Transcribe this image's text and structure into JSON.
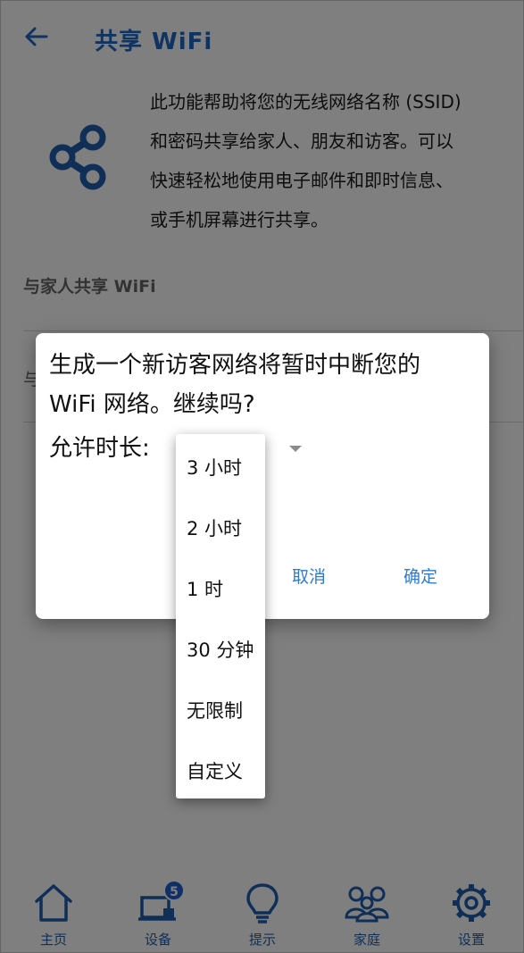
{
  "header": {
    "title": "共享 WiFi"
  },
  "intro": {
    "lines": [
      "此功能帮助将您的无线网络名称 (SSID)",
      "和密码共享给家人、朋友和访客。可以",
      "快速轻松地使用电子邮件和即时信息、",
      "或手机屏幕进行共享。"
    ]
  },
  "sections": {
    "family_label": "与家人共享 WiFi",
    "row2_partial": "与"
  },
  "dialog": {
    "message_line1": "生成一个新访客网络将暂时中断您的",
    "message_line2": "WiFi 网络。继续吗?",
    "duration_label": "允许时长:",
    "cancel_label": "取消",
    "ok_label": "确定"
  },
  "duration_menu": {
    "options": [
      "3 小时",
      "2 小时",
      "1 时",
      "30 分钟",
      "无限制",
      "自定义"
    ]
  },
  "bottom_nav": {
    "items": [
      {
        "label": "主页",
        "icon": "home-icon"
      },
      {
        "label": "设备",
        "icon": "devices-icon",
        "badge": "5"
      },
      {
        "label": "提示",
        "icon": "lightbulb-icon"
      },
      {
        "label": "家庭",
        "icon": "family-icon"
      },
      {
        "label": "设置",
        "icon": "gear-icon"
      }
    ]
  },
  "colors": {
    "accent": "#1f69c2",
    "overlay": "rgba(0,0,0,0.5)",
    "badge": "#1e5fd0"
  }
}
